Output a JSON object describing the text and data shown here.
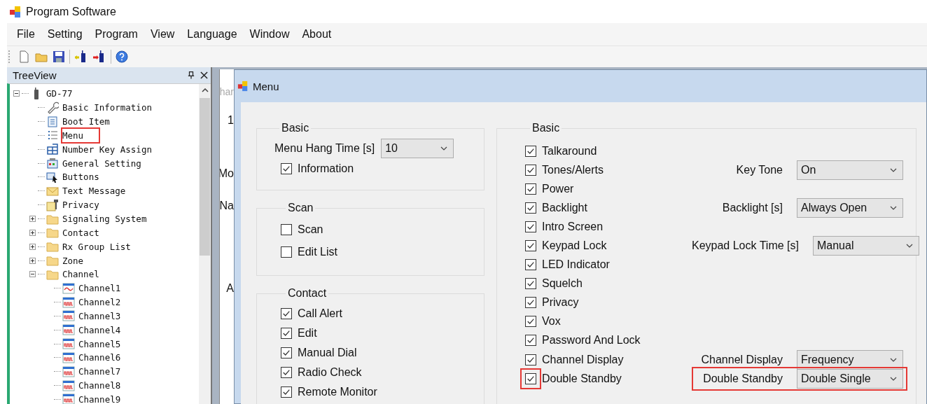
{
  "app": {
    "title": "Program Software"
  },
  "menubar": [
    "File",
    "Setting",
    "Program",
    "View",
    "Language",
    "Window",
    "About"
  ],
  "tree_panel": {
    "title": "TreeView",
    "items": [
      {
        "label": "GD-77",
        "kind": "radio",
        "expanded": true,
        "highlighted": false,
        "children": [
          {
            "label": "Basic Information",
            "kind": "wrench",
            "highlighted": false
          },
          {
            "label": "Boot Item",
            "kind": "document",
            "highlighted": false
          },
          {
            "label": "Menu",
            "kind": "list",
            "highlighted": true
          },
          {
            "label": "Number Key Assign",
            "kind": "grid",
            "highlighted": false
          },
          {
            "label": "General Setting",
            "kind": "settings",
            "highlighted": false
          },
          {
            "label": "Buttons",
            "kind": "cursor",
            "highlighted": false
          },
          {
            "label": "Text Message",
            "kind": "envelope",
            "highlighted": false
          },
          {
            "label": "Privacy",
            "kind": "key",
            "highlighted": false
          },
          {
            "label": "Signaling System",
            "kind": "folder",
            "expanded": false,
            "highlighted": false
          },
          {
            "label": "Contact",
            "kind": "folder",
            "expanded": false,
            "highlighted": false
          },
          {
            "label": "Rx Group List",
            "kind": "folder",
            "expanded": false,
            "highlighted": false
          },
          {
            "label": "Zone",
            "kind": "folder",
            "expanded": false,
            "highlighted": false
          },
          {
            "label": "Channel",
            "kind": "folder",
            "expanded": true,
            "highlighted": false,
            "children": [
              {
                "label": "Channel1",
                "kind": "analog",
                "highlighted": false
              },
              {
                "label": "Channel2",
                "kind": "digital",
                "highlighted": false
              },
              {
                "label": "Channel3",
                "kind": "digital",
                "highlighted": false
              },
              {
                "label": "Channel4",
                "kind": "digital",
                "highlighted": false
              },
              {
                "label": "Channel5",
                "kind": "digital",
                "highlighted": false
              },
              {
                "label": "Channel6",
                "kind": "digital",
                "highlighted": false
              },
              {
                "label": "Channel7",
                "kind": "digital",
                "highlighted": false
              },
              {
                "label": "Channel8",
                "kind": "digital",
                "highlighted": false
              },
              {
                "label": "Channel9",
                "kind": "digital",
                "highlighted": false
              }
            ]
          }
        ]
      }
    ]
  },
  "background_window": {
    "title": "har",
    "texts": [
      "1",
      "Mo",
      "Na",
      "A"
    ]
  },
  "menu_window": {
    "title": "Menu",
    "basic": {
      "title": "Basic",
      "hang_time": {
        "label": "Menu Hang Time [s]",
        "value": "10"
      },
      "options": [
        {
          "label": "Information",
          "checked": true
        }
      ]
    },
    "scan": {
      "title": "Scan",
      "options": [
        {
          "label": "Scan",
          "checked": false
        },
        {
          "label": "Edit List",
          "checked": false
        }
      ]
    },
    "contact": {
      "title": "Contact",
      "options": [
        {
          "label": "Call Alert",
          "checked": true
        },
        {
          "label": "Edit",
          "checked": true
        },
        {
          "label": "Manual Dial",
          "checked": true
        },
        {
          "label": "Radio Check",
          "checked": true
        },
        {
          "label": "Remote Monitor",
          "checked": true
        }
      ]
    },
    "basic_right": {
      "title": "Basic",
      "rows": [
        {
          "label": "Talkaround",
          "checked": true,
          "highlighted": false
        },
        {
          "label": "Tones/Alerts",
          "checked": true,
          "highlighted": false,
          "setting": {
            "label": "Key Tone",
            "value": "On",
            "highlighted": false
          }
        },
        {
          "label": "Power",
          "checked": true,
          "highlighted": false
        },
        {
          "label": "Backlight",
          "checked": true,
          "highlighted": false,
          "setting": {
            "label": "Backlight [s]",
            "value": "Always Open",
            "highlighted": false
          }
        },
        {
          "label": "Intro Screen",
          "checked": true,
          "highlighted": false
        },
        {
          "label": "Keypad Lock",
          "checked": true,
          "highlighted": false,
          "setting": {
            "label": "Keypad Lock Time [s]",
            "value": "Manual",
            "highlighted": false
          }
        },
        {
          "label": "LED Indicator",
          "checked": true,
          "highlighted": false
        },
        {
          "label": "Squelch",
          "checked": true,
          "highlighted": false
        },
        {
          "label": "Privacy",
          "checked": true,
          "highlighted": false
        },
        {
          "label": "Vox",
          "checked": true,
          "highlighted": false
        },
        {
          "label": "Password And Lock",
          "checked": true,
          "highlighted": false
        },
        {
          "label": "Channel Display",
          "checked": true,
          "highlighted": false,
          "setting": {
            "label": "Channel Display",
            "value": "Frequency",
            "highlighted": false
          }
        },
        {
          "label": "Double Standby",
          "checked": true,
          "highlighted": true,
          "setting": {
            "label": "Double Standby",
            "value": "Double Single",
            "highlighted": true
          }
        }
      ]
    }
  }
}
